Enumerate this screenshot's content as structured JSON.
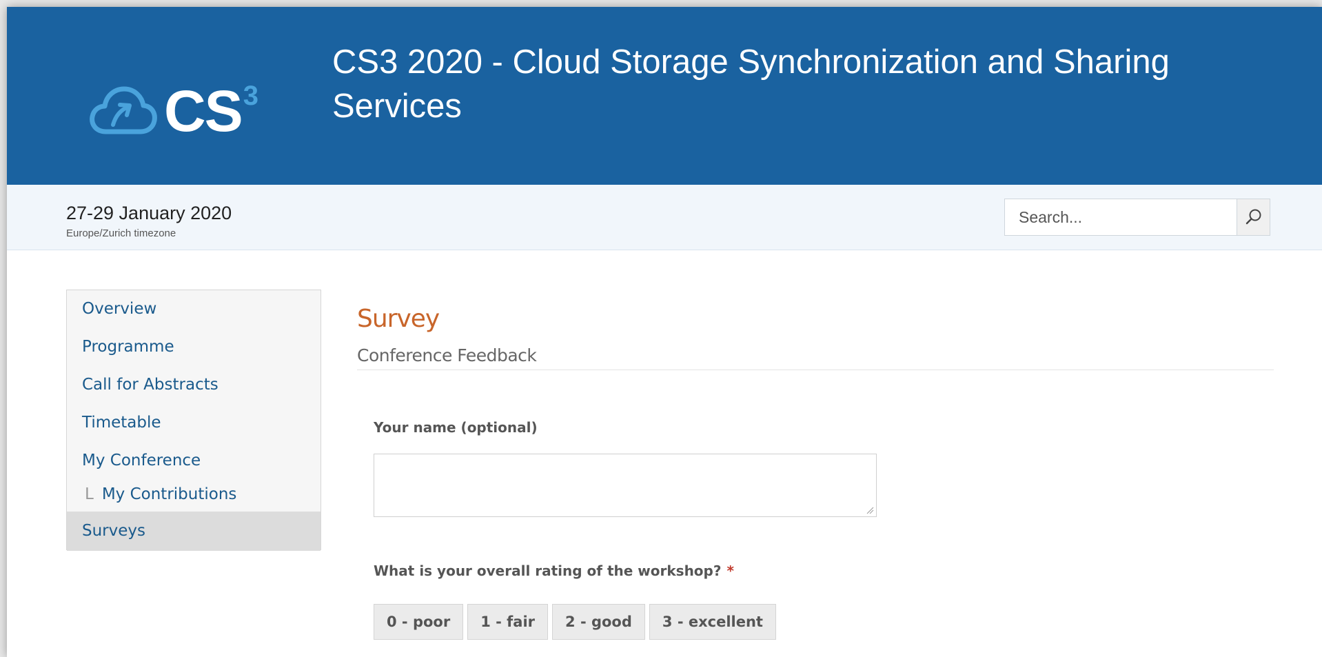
{
  "header": {
    "logo_text": "CS",
    "logo_superscript": "3",
    "title": "CS3 2020 - Cloud Storage Synchronization and Sharing Services"
  },
  "event": {
    "dates": "27-29 January 2020",
    "timezone": "Europe/Zurich timezone"
  },
  "search": {
    "placeholder": "Search..."
  },
  "sidebar": {
    "items": [
      {
        "label": "Overview"
      },
      {
        "label": "Programme"
      },
      {
        "label": "Call for Abstracts"
      },
      {
        "label": "Timetable"
      },
      {
        "label": "My Conference"
      },
      {
        "label": "My Contributions"
      },
      {
        "label": "Surveys"
      }
    ],
    "tree_glyph": "L"
  },
  "main": {
    "title": "Survey",
    "subtitle": "Conference Feedback",
    "questions": {
      "name_label": "Your name (optional)",
      "rating_label": "What is your overall rating of the workshop?",
      "required_mark": "*",
      "rating_options": [
        "0 - poor",
        "1 - fair",
        "2 - good",
        "3 - excellent"
      ]
    }
  },
  "colors": {
    "header_bg": "#1a62a0",
    "accent": "#c8652a",
    "link": "#1a5a8c"
  }
}
